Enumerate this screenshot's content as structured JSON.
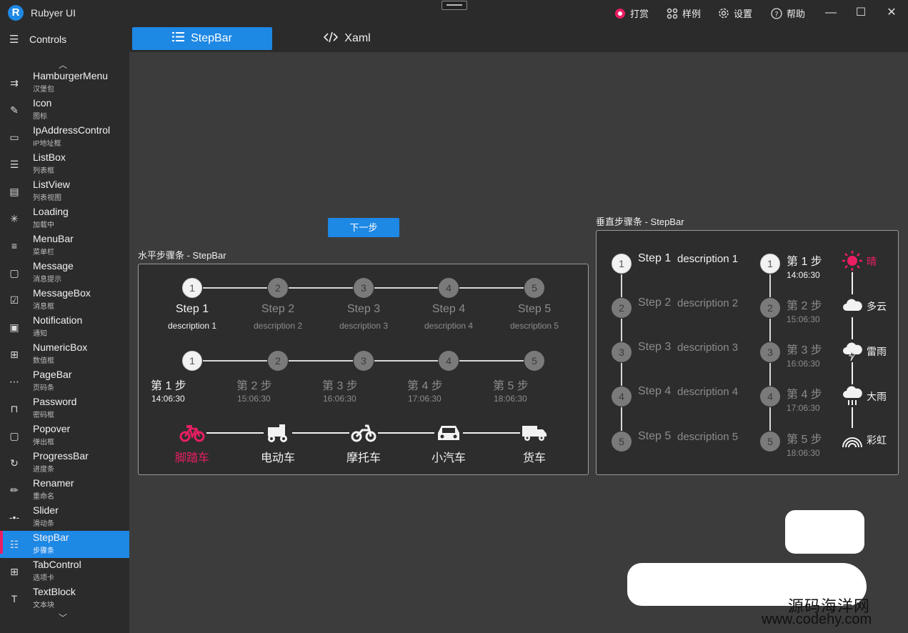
{
  "titlebar": {
    "logo_letter": "R",
    "app_title": "Rubyer UI",
    "reward_label": "打赏",
    "samples_label": "样例",
    "settings_label": "设置",
    "help_label": "帮助",
    "minimize": "—",
    "maximize": "☐",
    "close": "✕"
  },
  "sidebar": {
    "header": "Controls",
    "items": [
      {
        "en": "HamburgerMenu",
        "zh": "汉堡包",
        "icon": "menu-arrow-icon"
      },
      {
        "en": "Icon",
        "zh": "图标",
        "icon": "icon-edit-icon"
      },
      {
        "en": "IpAddressControl",
        "zh": "IP地址框",
        "icon": "rectangle-icon"
      },
      {
        "en": "ListBox",
        "zh": "列表框",
        "icon": "list-icon"
      },
      {
        "en": "ListView",
        "zh": "列表视图",
        "icon": "list-view-icon"
      },
      {
        "en": "Loading",
        "zh": "加载中",
        "icon": "loading-icon"
      },
      {
        "en": "MenuBar",
        "zh": "菜单栏",
        "icon": "menu-icon"
      },
      {
        "en": "Message",
        "zh": "消息提示",
        "icon": "message-icon"
      },
      {
        "en": "MessageBox",
        "zh": "消息框",
        "icon": "messagebox-icon"
      },
      {
        "en": "Notification",
        "zh": "通知",
        "icon": "notification-icon"
      },
      {
        "en": "NumericBox",
        "zh": "数值框",
        "icon": "plus-box-icon"
      },
      {
        "en": "PageBar",
        "zh": "页码条",
        "icon": "dots-icon"
      },
      {
        "en": "Password",
        "zh": "密码框",
        "icon": "lock-icon"
      },
      {
        "en": "Popover",
        "zh": "弹出框",
        "icon": "popover-icon"
      },
      {
        "en": "ProgressBar",
        "zh": "进度条",
        "icon": "progress-icon"
      },
      {
        "en": "Renamer",
        "zh": "重命名",
        "icon": "pencil-icon"
      },
      {
        "en": "Slider",
        "zh": "滑动条",
        "icon": "slider-icon"
      },
      {
        "en": "StepBar",
        "zh": "步骤条",
        "icon": "steps-icon",
        "active": true
      },
      {
        "en": "TabControl",
        "zh": "选项卡",
        "icon": "tab-icon"
      },
      {
        "en": "TextBlock",
        "zh": "文本块",
        "icon": "text-icon"
      }
    ]
  },
  "tabs": [
    {
      "label": "StepBar",
      "icon": "list-icon",
      "active": true
    },
    {
      "label": "Xaml",
      "icon": "code-icon",
      "active": false
    }
  ],
  "next_button": "下一步",
  "horizontal": {
    "title": "水平步骤条 - StepBar",
    "row1": [
      {
        "n": "1",
        "title": "Step 1",
        "desc": "description 1"
      },
      {
        "n": "2",
        "title": "Step 2",
        "desc": "description 2"
      },
      {
        "n": "3",
        "title": "Step 3",
        "desc": "description 3"
      },
      {
        "n": "4",
        "title": "Step 4",
        "desc": "description 4"
      },
      {
        "n": "5",
        "title": "Step 5",
        "desc": "description 5"
      }
    ],
    "row2": [
      {
        "n": "1",
        "title": "第 1 步",
        "time": "14:06:30"
      },
      {
        "n": "2",
        "title": "第 2 步",
        "time": "15:06:30"
      },
      {
        "n": "3",
        "title": "第 3 步",
        "time": "16:06:30"
      },
      {
        "n": "4",
        "title": "第 4 步",
        "time": "17:06:30"
      },
      {
        "n": "5",
        "title": "第 5 步",
        "time": "18:06:30"
      }
    ],
    "row3": [
      {
        "label": "脚踏车",
        "icon": "bicycle-icon"
      },
      {
        "label": "电动车",
        "icon": "scooter-icon"
      },
      {
        "label": "摩托车",
        "icon": "motorcycle-icon"
      },
      {
        "label": "小汽车",
        "icon": "car-icon"
      },
      {
        "label": "货车",
        "icon": "truck-icon"
      }
    ],
    "active_color": "#e91e63"
  },
  "vertical": {
    "title": "垂直步骤条 - StepBar",
    "col1": [
      {
        "n": "1",
        "title": "Step 1",
        "desc": "description 1"
      },
      {
        "n": "2",
        "title": "Step 2",
        "desc": "description 2"
      },
      {
        "n": "3",
        "title": "Step 3",
        "desc": "description 3"
      },
      {
        "n": "4",
        "title": "Step 4",
        "desc": "description 4"
      },
      {
        "n": "5",
        "title": "Step 5",
        "desc": "description 5"
      }
    ],
    "col2": [
      {
        "n": "1",
        "title": "第 1 步",
        "time": "14:06:30"
      },
      {
        "n": "2",
        "title": "第 2 步",
        "time": "15:06:30"
      },
      {
        "n": "3",
        "title": "第 3 步",
        "time": "16:06:30"
      },
      {
        "n": "4",
        "title": "第 4 步",
        "time": "17:06:30"
      },
      {
        "n": "5",
        "title": "第 5 步",
        "time": "18:06:30"
      }
    ],
    "col3": [
      {
        "label": "晴",
        "icon": "sun-icon"
      },
      {
        "label": "多云",
        "icon": "cloud-icon"
      },
      {
        "label": "雷雨",
        "icon": "thunderstorm-icon"
      },
      {
        "label": "大雨",
        "icon": "heavy-rain-icon"
      },
      {
        "label": "彩虹",
        "icon": "rainbow-icon"
      }
    ]
  },
  "watermark": {
    "line1": "源码海洋网",
    "line2": "www.codehy.com"
  }
}
